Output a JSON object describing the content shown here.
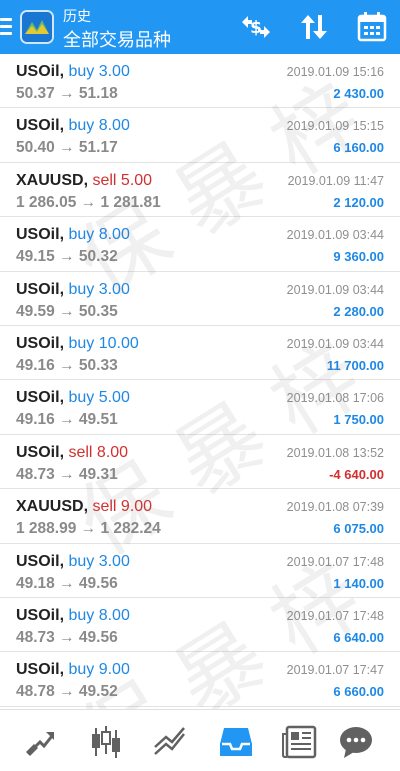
{
  "header": {
    "subtitle": "历史",
    "title": "全部交易品种",
    "colors": {
      "bar": "#2196f3",
      "buy": "#1e88e5",
      "sell": "#d32f2f"
    }
  },
  "watermark": "保 暴 梓",
  "deals": [
    {
      "symbol": "USOil,",
      "direction": "buy 3.00",
      "side": "buy",
      "prices": "50.37 → 51.18",
      "time": "2019.01.09 15:16",
      "profit": "2 430.00"
    },
    {
      "symbol": "USOil,",
      "direction": "buy 8.00",
      "side": "buy",
      "prices": "50.40 → 51.17",
      "time": "2019.01.09 15:15",
      "profit": "6 160.00"
    },
    {
      "symbol": "XAUUSD,",
      "direction": "sell 5.00",
      "side": "sell",
      "prices": "1 286.05 → 1 281.81",
      "time": "2019.01.09 11:47",
      "profit": "2 120.00"
    },
    {
      "symbol": "USOil,",
      "direction": "buy 8.00",
      "side": "buy",
      "prices": "49.15 → 50.32",
      "time": "2019.01.09 03:44",
      "profit": "9 360.00"
    },
    {
      "symbol": "USOil,",
      "direction": "buy 3.00",
      "side": "buy",
      "prices": "49.59 → 50.35",
      "time": "2019.01.09 03:44",
      "profit": "2 280.00"
    },
    {
      "symbol": "USOil,",
      "direction": "buy 10.00",
      "side": "buy",
      "prices": "49.16 → 50.33",
      "time": "2019.01.09 03:44",
      "profit": "11 700.00"
    },
    {
      "symbol": "USOil,",
      "direction": "buy 5.00",
      "side": "buy",
      "prices": "49.16 → 49.51",
      "time": "2019.01.08 17:06",
      "profit": "1 750.00"
    },
    {
      "symbol": "USOil,",
      "direction": "sell 8.00",
      "side": "sell",
      "prices": "48.73 → 49.31",
      "time": "2019.01.08 13:52",
      "profit": "-4 640.00",
      "negative": true
    },
    {
      "symbol": "XAUUSD,",
      "direction": "sell 9.00",
      "side": "sell",
      "prices": "1 288.99 → 1 282.24",
      "time": "2019.01.08 07:39",
      "profit": "6 075.00"
    },
    {
      "symbol": "USOil,",
      "direction": "buy 3.00",
      "side": "buy",
      "prices": "49.18 → 49.56",
      "time": "2019.01.07 17:48",
      "profit": "1 140.00"
    },
    {
      "symbol": "USOil,",
      "direction": "buy 8.00",
      "side": "buy",
      "prices": "48.73 → 49.56",
      "time": "2019.01.07 17:48",
      "profit": "6 640.00"
    },
    {
      "symbol": "USOil,",
      "direction": "buy 9.00",
      "side": "buy",
      "prices": "48.78 → 49.52",
      "time": "2019.01.07 17:47",
      "profit": "6 660.00"
    }
  ],
  "tabs": [
    {
      "name": "tab-quotes",
      "icon": "trend-arrow-icon",
      "active": false
    },
    {
      "name": "tab-chart",
      "icon": "candlestick-icon",
      "active": false
    },
    {
      "name": "tab-trade",
      "icon": "line-chart-icon",
      "active": false
    },
    {
      "name": "tab-history",
      "icon": "inbox-tray-icon",
      "active": true
    },
    {
      "name": "tab-news",
      "icon": "newspaper-icon",
      "active": false
    },
    {
      "name": "tab-chat",
      "icon": "chat-bubble-icon",
      "active": false
    }
  ]
}
